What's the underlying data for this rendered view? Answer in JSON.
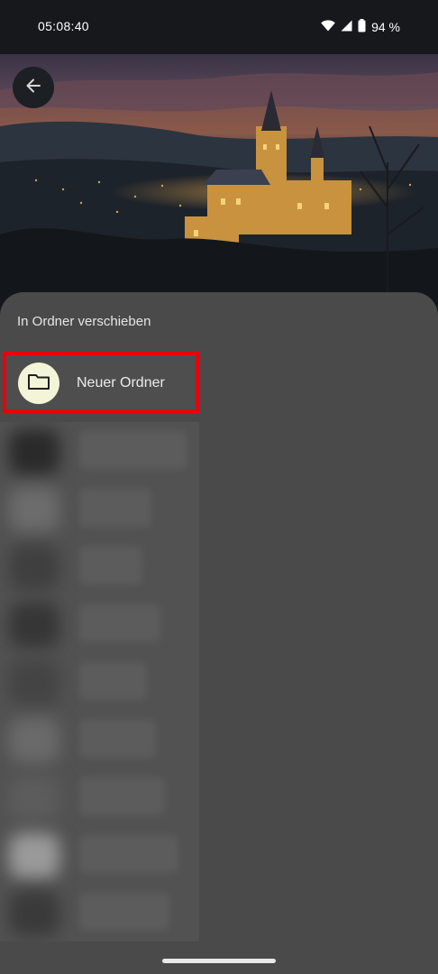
{
  "status_bar": {
    "time": "05:08:40",
    "battery": "94 %",
    "icons": [
      "wifi-icon",
      "cell-signal-icon",
      "battery-icon"
    ]
  },
  "header": {
    "back_icon": "arrow-left-icon"
  },
  "sheet": {
    "title": "In Ordner verschieben",
    "new_folder": {
      "label": "Neuer Ordner",
      "icon": "folder-icon",
      "highlight_color": "#e8000b"
    },
    "blurred_items_count": 9
  },
  "colors": {
    "sheet_background": "#4a4a4a",
    "status_bar": "#16181c",
    "folder_circle": "#f3f5d8"
  }
}
